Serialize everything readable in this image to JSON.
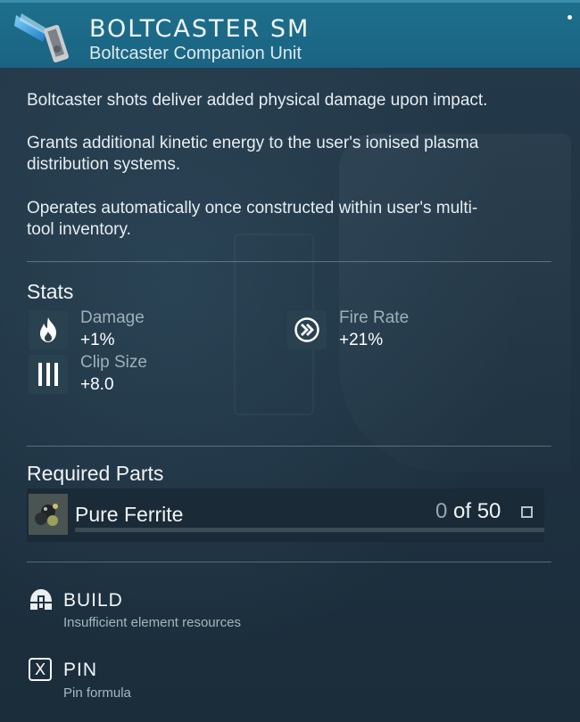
{
  "item": {
    "title": "BOLTCASTER SM",
    "subtitle": "Boltcaster Companion Unit",
    "icon": "boltcaster-module-icon"
  },
  "description": [
    "Boltcaster shots deliver added physical damage upon impact.",
    "Grants additional kinetic energy to the user's ionised plasma distribution systems.",
    "Operates automatically once constructed within user's multi-tool inventory."
  ],
  "stats": {
    "heading": "Stats",
    "items": [
      {
        "name": "Damage",
        "value": "+1%",
        "icon": "flame-icon"
      },
      {
        "name": "Fire Rate",
        "value": "+21%",
        "icon": "double-chevron-icon"
      },
      {
        "name": "Clip Size",
        "value": "+8.0",
        "icon": "clip-bars-icon"
      }
    ]
  },
  "required_parts": {
    "heading": "Required Parts",
    "items": [
      {
        "name": "Pure Ferrite",
        "have": "0",
        "of_text": " of 50",
        "progress": 0.0,
        "icon": "ferrite-resource-icon"
      }
    ]
  },
  "actions": [
    {
      "label": "BUILD",
      "sub": "Insufficient element resources",
      "icon": "build-helmet-icon"
    },
    {
      "label": "PIN",
      "sub": "Pin formula",
      "key": "X"
    }
  ],
  "colors": {
    "header": "#1a6482",
    "background": "#1f3341",
    "accent_blue": "#2a8fd6"
  }
}
